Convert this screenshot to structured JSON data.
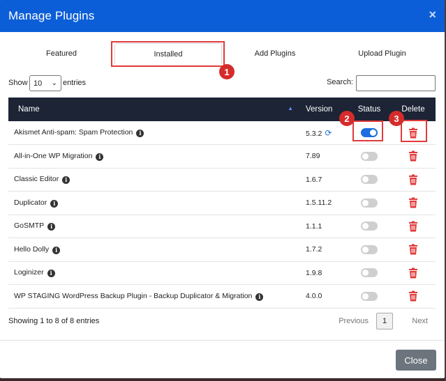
{
  "modal": {
    "title": "Manage Plugins",
    "close_icon": "×"
  },
  "tabs": [
    {
      "label": "Featured",
      "active": false
    },
    {
      "label": "Installed",
      "active": true
    },
    {
      "label": "Add Plugins",
      "active": false
    },
    {
      "label": "Upload Plugin",
      "active": false
    }
  ],
  "controls": {
    "show_label": "Show",
    "entries_value": "10",
    "entries_label": "entries",
    "search_label": "Search:",
    "search_value": ""
  },
  "table": {
    "headers": {
      "name": "Name",
      "version": "Version",
      "status": "Status",
      "delete": "Delete"
    },
    "rows": [
      {
        "name": "Akismet Anti-spam: Spam Protection",
        "version": "5.3.2",
        "update_available": true,
        "active": true
      },
      {
        "name": "All-in-One WP Migration",
        "version": "7.89",
        "update_available": false,
        "active": false
      },
      {
        "name": "Classic Editor",
        "version": "1.6.7",
        "update_available": false,
        "active": false
      },
      {
        "name": "Duplicator",
        "version": "1.5.11.2",
        "update_available": false,
        "active": false
      },
      {
        "name": "GoSMTP",
        "version": "1.1.1",
        "update_available": false,
        "active": false
      },
      {
        "name": "Hello Dolly",
        "version": "1.7.2",
        "update_available": false,
        "active": false
      },
      {
        "name": "Loginizer",
        "version": "1.9.8",
        "update_available": false,
        "active": false
      },
      {
        "name": "WP STAGING WordPress Backup Plugin - Backup Duplicator & Migration",
        "version": "4.0.0",
        "update_available": false,
        "active": false
      }
    ]
  },
  "footer": {
    "info": "Showing 1 to 8 of 8 entries",
    "prev_label": "Previous",
    "page": "1",
    "next_label": "Next",
    "close_label": "Close"
  },
  "annotations": [
    "1",
    "2",
    "3"
  ],
  "colors": {
    "header": "#0b5ed7",
    "table_head": "#1c2435",
    "toggle_on": "#1b6fe0",
    "trash": "#e03a3a",
    "highlight": "#e03a3a"
  }
}
